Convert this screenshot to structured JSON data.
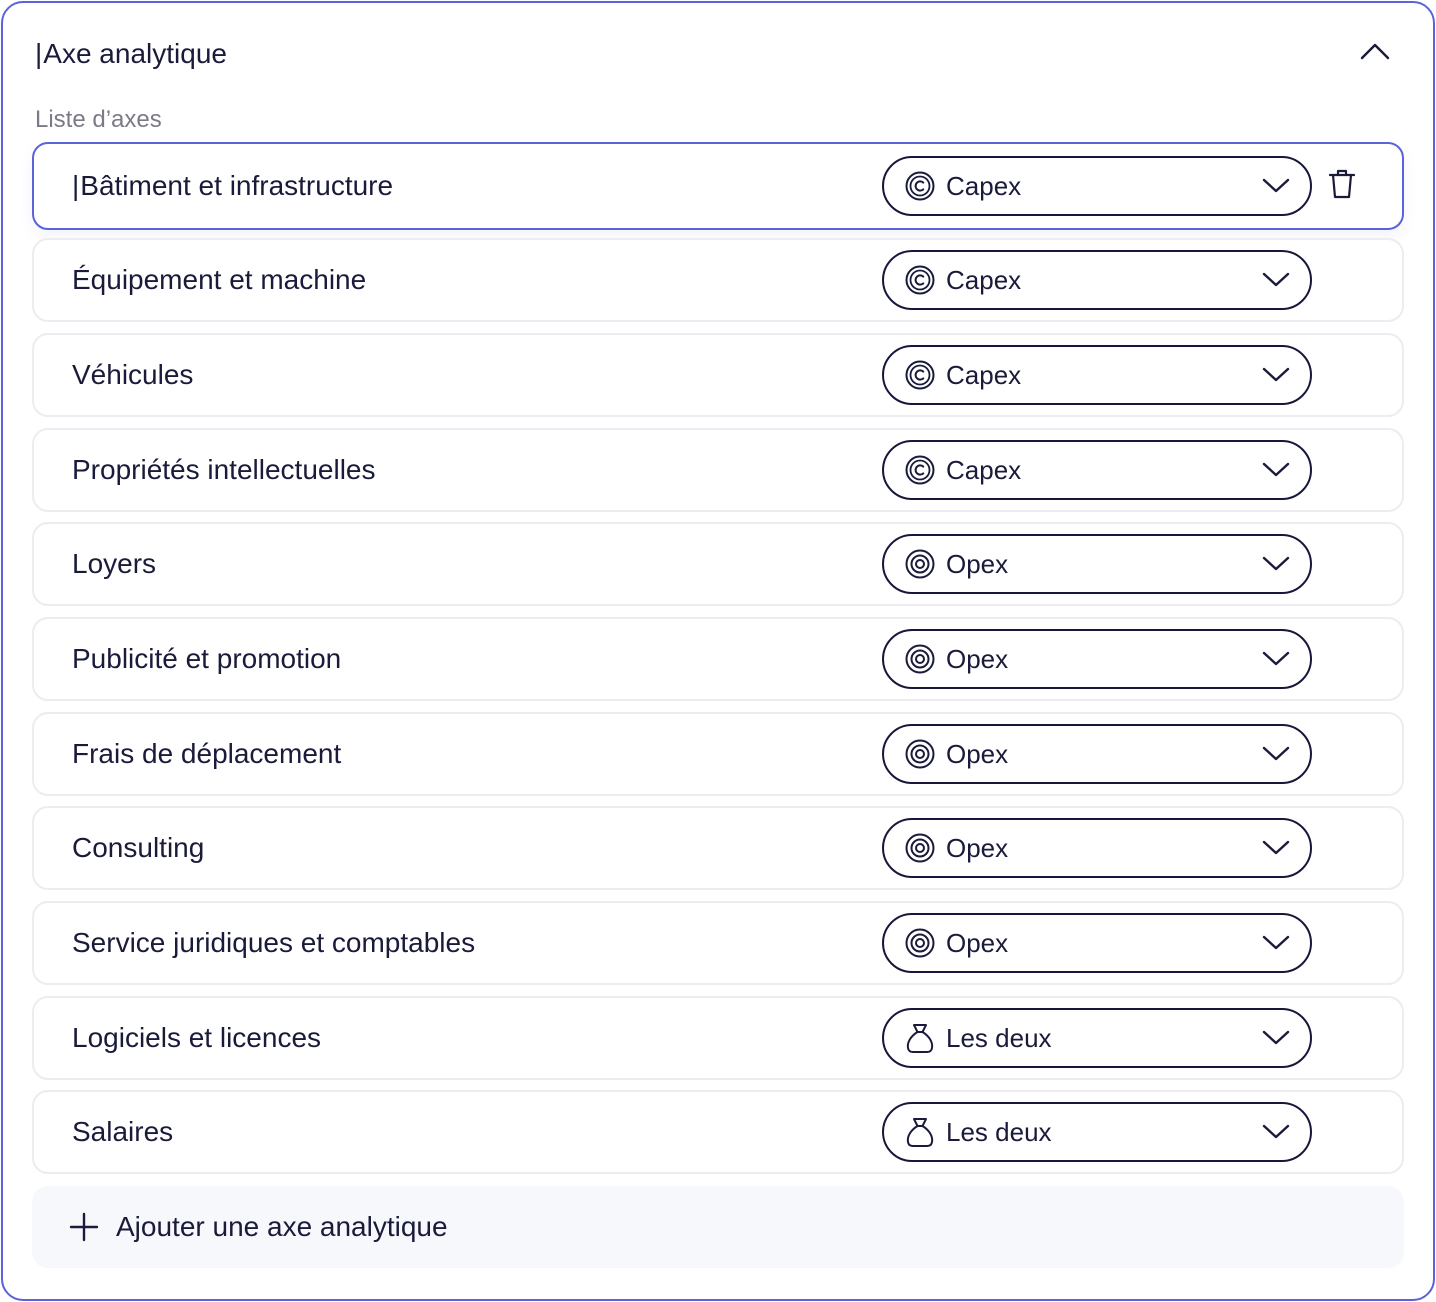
{
  "panel": {
    "title": "Axe analytique",
    "caret": "|",
    "list_label": "Liste d’axes",
    "collapse_icon": "chevron-up-icon"
  },
  "rows": [
    {
      "label": "Bâtiment et infrastructure",
      "type": "Capex",
      "icon": "capex-icon",
      "active": true
    },
    {
      "label": "Équipement et machine",
      "type": "Capex",
      "icon": "capex-icon"
    },
    {
      "label": "Véhicules",
      "type": "Capex",
      "icon": "capex-icon"
    },
    {
      "label": "Propriétés intellectuelles",
      "type": "Capex",
      "icon": "capex-icon"
    },
    {
      "label": "Loyers",
      "type": "Opex",
      "icon": "opex-icon"
    },
    {
      "label": "Publicité et promotion",
      "type": "Opex",
      "icon": "opex-icon"
    },
    {
      "label": "Frais de déplacement",
      "type": "Opex",
      "icon": "opex-icon"
    },
    {
      "label": "Consulting",
      "type": "Opex",
      "icon": "opex-icon"
    },
    {
      "label": "Service juridiques et comptables",
      "type": "Opex",
      "icon": "opex-icon"
    },
    {
      "label": "Logiciels et licences",
      "type": "Les deux",
      "icon": "money-bag-icon"
    },
    {
      "label": "Salaires",
      "type": "Les deux",
      "icon": "money-bag-icon"
    }
  ],
  "add_button": {
    "label": "Ajouter une axe analytique",
    "icon": "plus-icon"
  },
  "colors": {
    "accent": "#5a63d8",
    "text": "#1a1b3a",
    "muted": "#7a7b87",
    "row_border": "#ececf1"
  }
}
